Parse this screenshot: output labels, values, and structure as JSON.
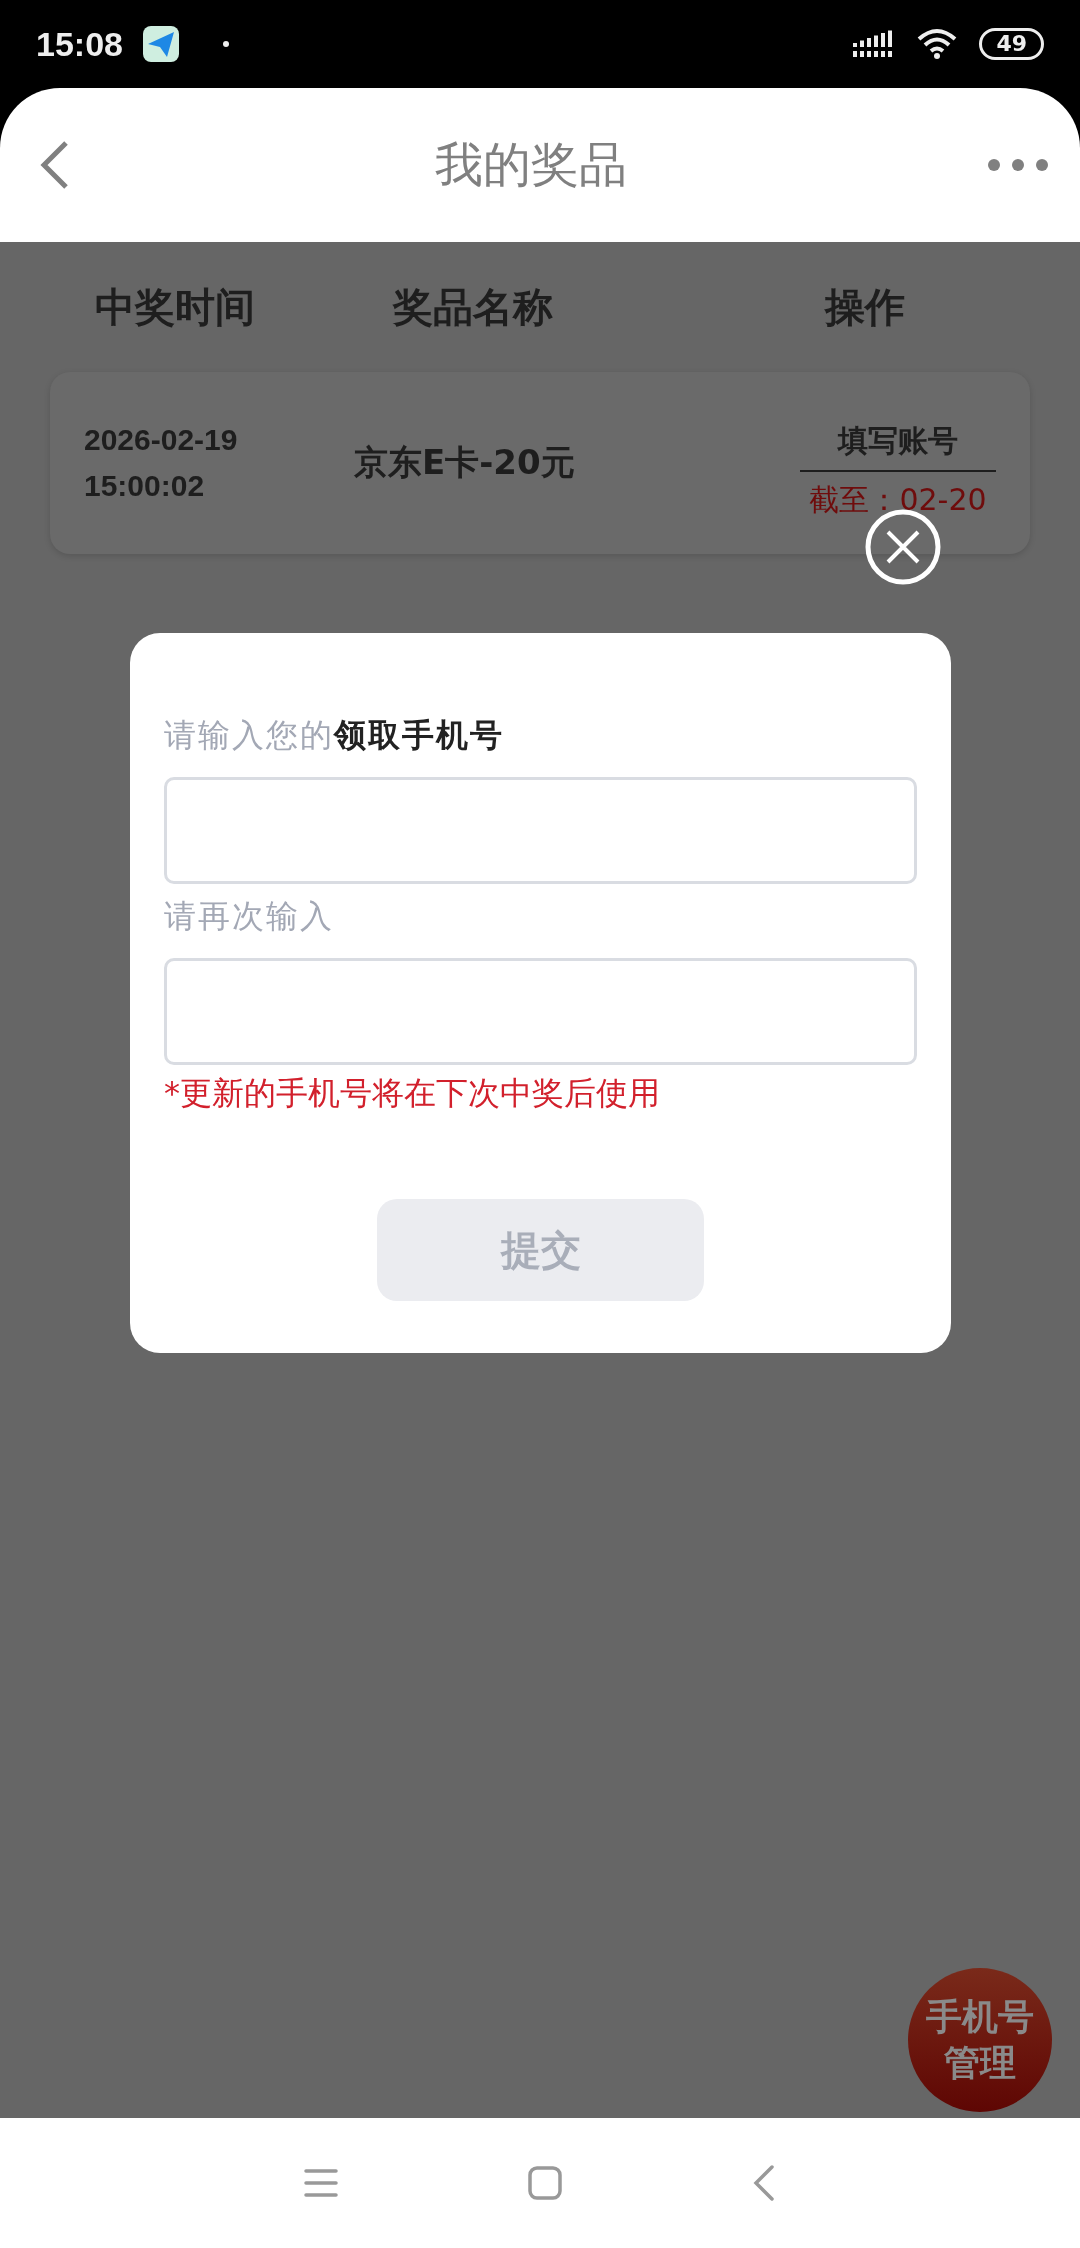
{
  "status_bar": {
    "time": "15:08",
    "battery": "49"
  },
  "header": {
    "title": "我的奖品"
  },
  "table": {
    "columns": [
      "中奖时间",
      "奖品名称",
      "操作"
    ],
    "rows": [
      {
        "date": "2026-02-19",
        "clock": "15:00:02",
        "prize": "京东E卡-20元",
        "action": "填写账号",
        "deadline": "截至：02-20"
      }
    ]
  },
  "dialog": {
    "fields": [
      {
        "label": "请输入您的**领取手机号**"
      },
      {
        "label": "请再次输入"
      }
    ],
    "note": "*更新的手机号将在下次中奖后使用",
    "submit": {
      "label": "提交",
      "disabled": true
    }
  },
  "fab": {
    "label": "手机号管理"
  }
}
